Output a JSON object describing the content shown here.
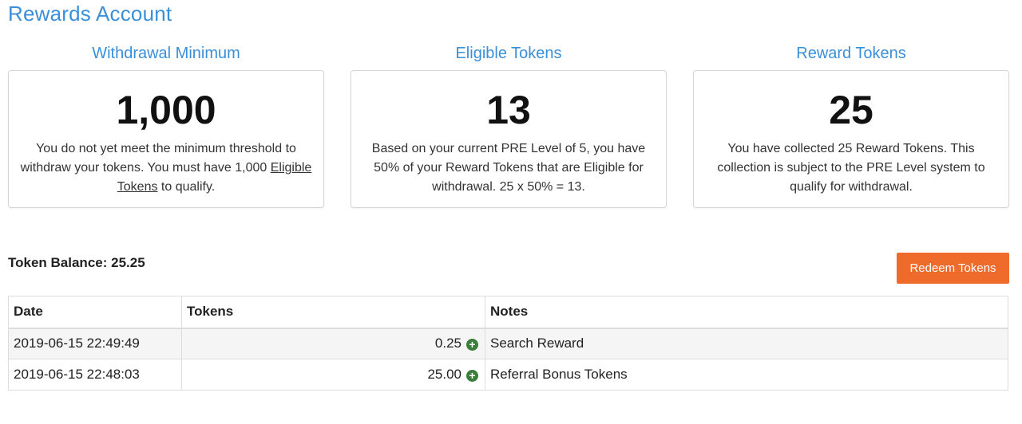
{
  "page": {
    "title": "Rewards Account"
  },
  "cards": [
    {
      "heading": "Withdrawal Minimum",
      "value": "1,000",
      "text_before": "You do not yet meet the minimum threshold to withdraw your tokens. You must have 1,000 ",
      "link": "Eligible Tokens",
      "text_after": " to qualify."
    },
    {
      "heading": "Eligible Tokens",
      "value": "13",
      "text": "Based on your current PRE Level of 5, you have 50% of your Reward Tokens that are Eligible for withdrawal. 25 x 50% = 13."
    },
    {
      "heading": "Reward Tokens",
      "value": "25",
      "text": "You have collected 25 Reward Tokens. This collection is subject to the PRE Level system to qualify for withdrawal."
    }
  ],
  "balance": {
    "label": "Token Balance:",
    "value": "25.25"
  },
  "redeem_button": "Redeem Tokens",
  "table": {
    "headers": [
      "Date",
      "Tokens",
      "Notes"
    ],
    "rows": [
      {
        "date": "2019-06-15 22:49:49",
        "tokens": "0.25",
        "notes": "Search Reward"
      },
      {
        "date": "2019-06-15 22:48:03",
        "tokens": "25.00",
        "notes": "Referral Bonus Tokens"
      }
    ]
  },
  "icons": {
    "row_icon": "plus-circle-icon"
  },
  "colors": {
    "accent": "#3a8fd9",
    "button": "#ef6b2c",
    "plus": "#3b7d3b"
  }
}
